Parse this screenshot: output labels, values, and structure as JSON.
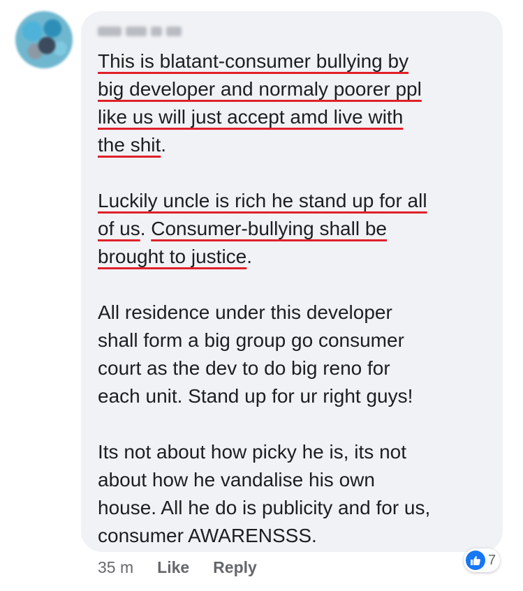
{
  "comment": {
    "author": "",
    "paragraphs": [
      [
        [
          {
            "text": "This is blatant-consumer bullying by",
            "u": true
          }
        ],
        [
          {
            "text": "big developer and normaly poorer ppl",
            "u": true
          }
        ],
        [
          {
            "text": "like us will just accept amd live with",
            "u": true
          }
        ],
        [
          {
            "text": "the shit",
            "u": true
          },
          {
            "text": ".",
            "u": false
          }
        ]
      ],
      [
        [
          {
            "text": "Luckily uncle is rich he stand up for all",
            "u": true
          }
        ],
        [
          {
            "text": "of us",
            "u": true
          },
          {
            "text": ". ",
            "u": false
          },
          {
            "text": "Consumer-bullying shall be",
            "u": true
          }
        ],
        [
          {
            "text": "brought to justice",
            "u": true
          },
          {
            "text": ".",
            "u": false
          }
        ]
      ],
      [
        [
          {
            "text": "All residence under this developer",
            "u": false
          }
        ],
        [
          {
            "text": "shall form a big group go consumer",
            "u": false
          }
        ],
        [
          {
            "text": "court as the dev to do big reno for",
            "u": false
          }
        ],
        [
          {
            "text": "each unit. Stand up for ur right guys!",
            "u": false
          }
        ]
      ],
      [
        [
          {
            "text": "Its not about how picky he is, its not",
            "u": false
          }
        ],
        [
          {
            "text": "about how he vandalise his own",
            "u": false
          }
        ],
        [
          {
            "text": "house. All he do is publicity and for us,",
            "u": false
          }
        ],
        [
          {
            "text": "consumer AWARENSSS.",
            "u": false
          }
        ]
      ]
    ],
    "time": "35 m",
    "like_label": "Like",
    "reply_label": "Reply",
    "reaction_count": "7"
  },
  "colors": {
    "underline": "#e0202a",
    "bubble": "#f0f2f5",
    "like_blue": "#1877f2",
    "meta_gray": "#65676b"
  },
  "icons": {
    "reaction": "thumbs-up-icon"
  }
}
